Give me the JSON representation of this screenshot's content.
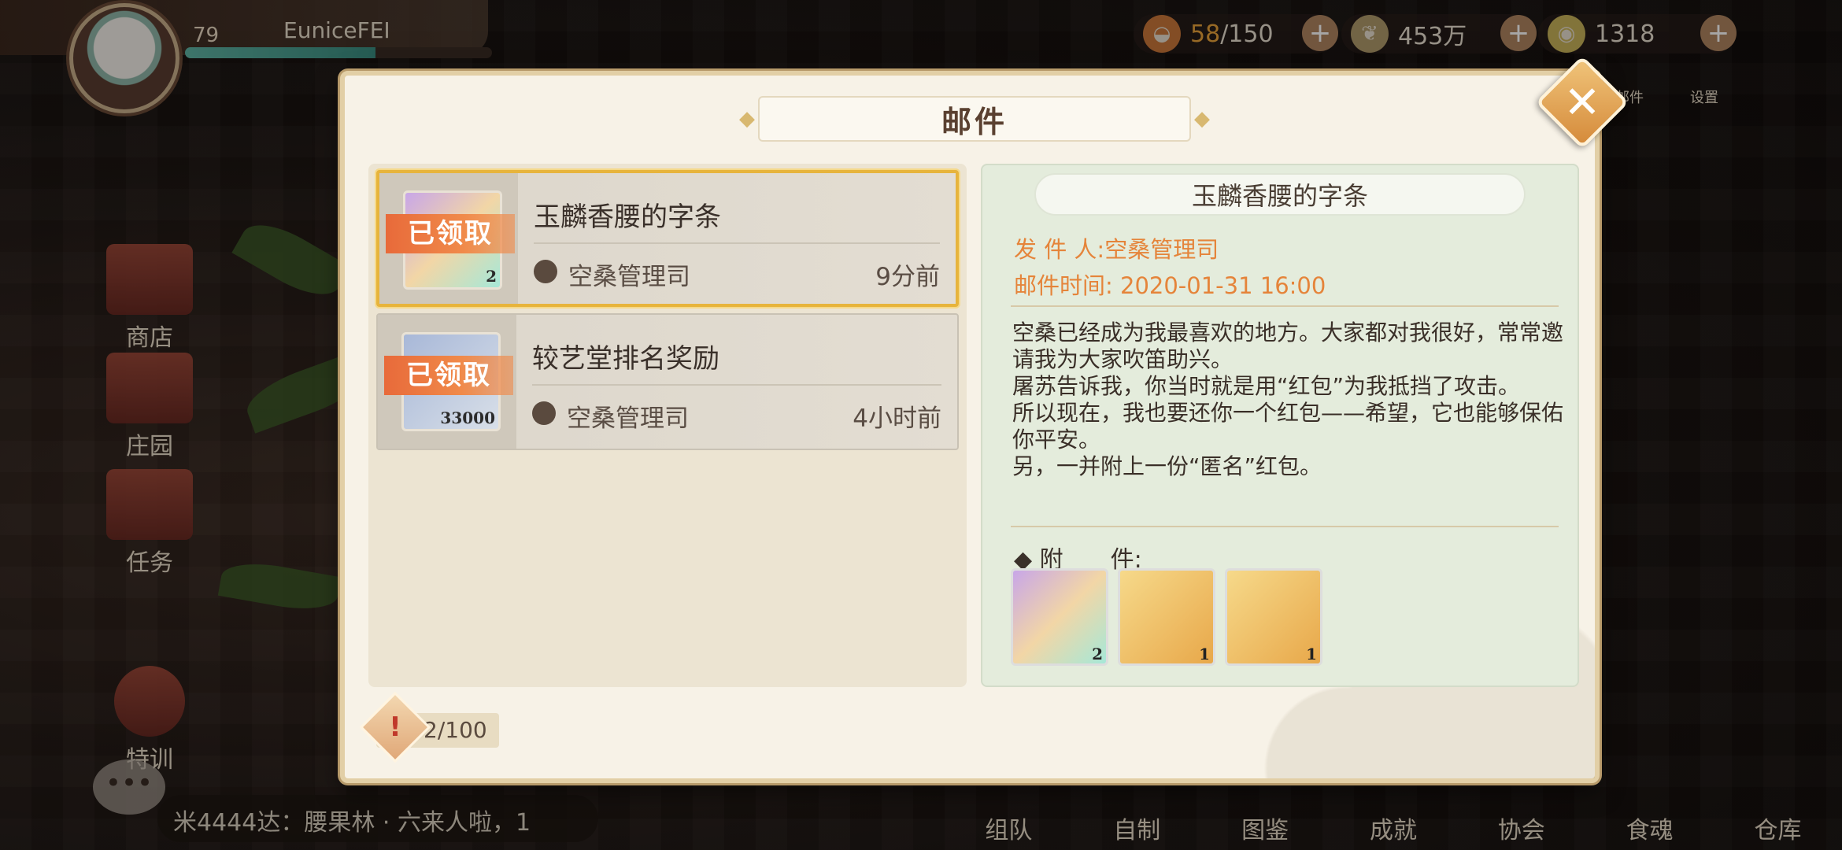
{
  "player": {
    "level": "79",
    "name": "EuniceFEI",
    "exp_fraction": 0.62
  },
  "resources": [
    {
      "icon": "stamina-bowl-icon",
      "value_highlight": "58",
      "value_rest": "/150"
    },
    {
      "icon": "coin-icon",
      "value_highlight": "",
      "value_rest": "453万"
    },
    {
      "icon": "gem-icon",
      "value_highlight": "",
      "value_rest": "1318"
    }
  ],
  "side_menu": [
    "商店",
    "庄园",
    "任务",
    "特训"
  ],
  "right_icons": [
    "邮件",
    "设置"
  ],
  "bottom_tabs": [
    "组队",
    "自制",
    "图鉴",
    "成就",
    "协会",
    "食魂",
    "仓库"
  ],
  "chat_line": "米4444达：腰果林 · 六来人啦，1",
  "modal": {
    "title": "邮件",
    "close_glyph": "✕",
    "mail_list": [
      {
        "subject": "玉麟香腰的字条",
        "sender": "空桑管理司",
        "time": "9分前",
        "stamp": "已领取",
        "qty": "2",
        "selected": true
      },
      {
        "subject": "较艺堂排名奖励",
        "sender": "空桑管理司",
        "time": "4小时前",
        "stamp": "已领取",
        "qty": "33000",
        "selected": false
      }
    ],
    "detail": {
      "title": "玉麟香腰的字条",
      "sender_label": "发 件 人:",
      "sender": "空桑管理司",
      "time_label": "邮件时间:",
      "time": "2020-01-31 16:00",
      "body": [
        "空桑已经成为我最喜欢的地方。大家都对我很好，常常邀请我为大家吹笛助兴。",
        "屠苏告诉我，你当时就是用“红包”为我抵挡了攻击。",
        "所以现在，我也要还你一个红包——希望，它也能够保佑你平安。",
        "另，一并附上一份“匿名”红包。"
      ],
      "attach_label": "◆ 附　　件:",
      "attachments": [
        {
          "name": "red-envelope-item-icon",
          "qty": "2"
        },
        {
          "name": "golden-leaf-item-icon",
          "qty": "1"
        },
        {
          "name": "book-item-icon",
          "qty": "1"
        }
      ]
    },
    "counter": {
      "glyph": "!",
      "text": "2/100"
    }
  },
  "colors": {
    "accent_orange": "#e5843a",
    "selected_border": "#e7b43c",
    "stamp": "#e86a3a"
  }
}
